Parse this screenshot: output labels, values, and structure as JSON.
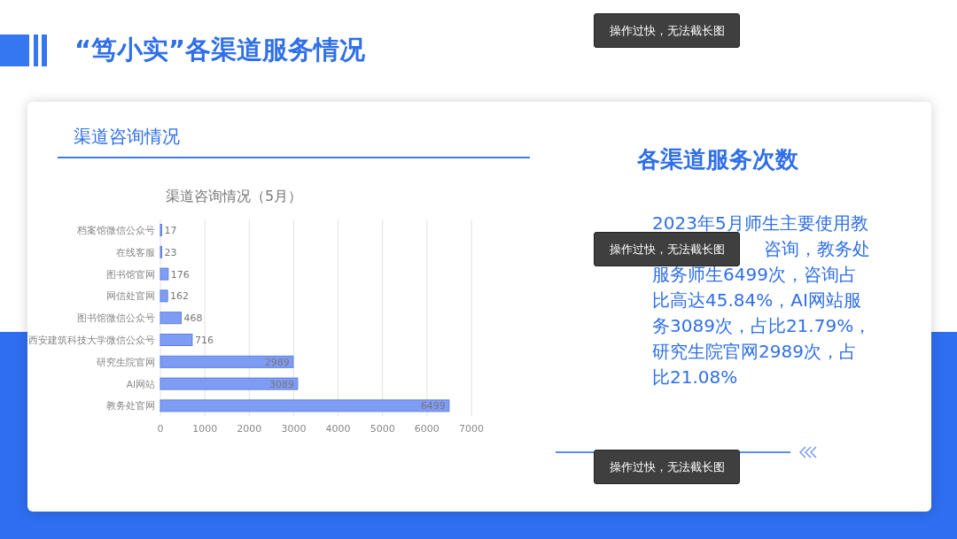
{
  "slide_title": "“笃小实”各渠道服务情况",
  "card": {
    "subtitle": "渠道咨询情况",
    "chart_data": {
      "type": "bar",
      "orientation": "horizontal",
      "title": "渠道咨询情况（5月）",
      "categories": [
        "档案馆微信公众号",
        "在线客服",
        "图书馆官网",
        "网信处官网",
        "图书馆微信公众号",
        "西安建筑科技大学微信公众号",
        "研究生院官网",
        "AI网站",
        "教务处官网"
      ],
      "series": [
        {
          "color": "#7f9cf5",
          "values": [
            17,
            23,
            176,
            162,
            468,
            716,
            2989,
            3089,
            6499
          ]
        }
      ],
      "xlim": [
        0,
        7000
      ],
      "grid": true,
      "xticks": [
        0,
        1000,
        2000,
        3000,
        4000,
        5000,
        6000,
        7000
      ],
      "data_labels": true
    },
    "summary_heading": "各渠道服务次数",
    "summary_first_line": "2023年5月师生主要使用教",
    "summary_partly_hidden_line": "咨询，教务处",
    "summary_rest_lines": [
      "服务师生6499次，咨询占",
      "比高达45.84%，AI网站服",
      "务3089次，占比21.79%，",
      "研究生院官网2989次，占",
      "比21.08%"
    ]
  },
  "toasts": [
    {
      "text": "操作过快，无法截长图"
    },
    {
      "text": "操作过快，无法截长图"
    },
    {
      "text": "操作过快，无法截长图"
    }
  ]
}
